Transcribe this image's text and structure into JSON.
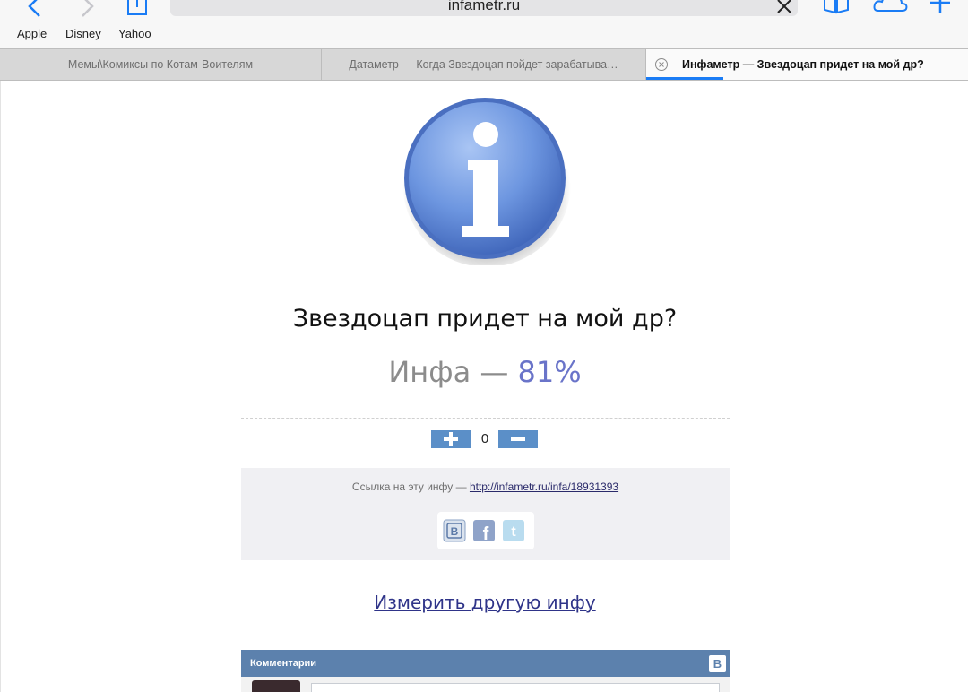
{
  "browser": {
    "url": "infametr.ru",
    "favorites": [
      "Apple",
      "Disney",
      "Yahoo"
    ],
    "accent_color": "#1a7cf5",
    "tabs": [
      {
        "title": "Мемы\\Комиксы по Котам-Воителям"
      },
      {
        "title": "Датаметр — Когда Звездоцап пойдет зарабатыва…"
      },
      {
        "title": "Инфаметр — Звездоцап придет на мой др?",
        "active": true
      }
    ]
  },
  "page": {
    "question": "Звездоцап придет на мой др?",
    "result_label": "Инфа",
    "result_separator": "—",
    "result_value": "81%",
    "vote_count": "0",
    "link_text": "Ссылка на эту инфу —",
    "link_url": "http://infametr.ru/infa/18931393",
    "share_icons": [
      "vk-icon",
      "facebook-icon",
      "twitter-icon"
    ],
    "another_link": "Измерить другую инфу",
    "comments_title": "Комментарии",
    "comments_badge": "В",
    "colors": {
      "result_value": "#6a74c9",
      "vote_buttons": "#5b8fc8",
      "comments_header": "#5c81ad"
    }
  }
}
